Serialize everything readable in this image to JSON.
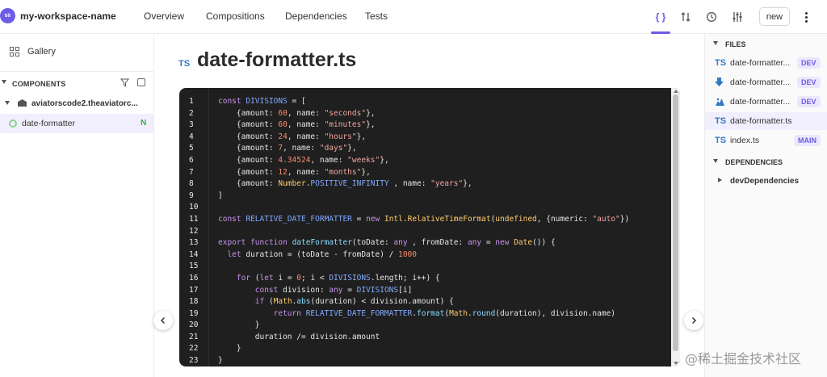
{
  "workspace": {
    "logo_text": "bit",
    "name": "my-workspace-name"
  },
  "nav": {
    "tabs": [
      {
        "label": "Overview"
      },
      {
        "label": "Compositions"
      },
      {
        "label": "Dependencies"
      },
      {
        "label": "Tests"
      }
    ]
  },
  "toolbar": {
    "icons": [
      "code-icon",
      "compare-icon",
      "history-icon",
      "settings-sliders-icon"
    ],
    "code_glyph": "{ }",
    "new_label": "new"
  },
  "sidebar": {
    "gallery_label": "Gallery",
    "components_header": "COMPONENTS",
    "scope_label": "aviatorscode2.theaviatorc...",
    "component": {
      "label": "date-formatter",
      "status": "N"
    }
  },
  "main": {
    "file_type": "TS",
    "title": "date-formatter.ts",
    "code_lines": [
      "const DIVISIONS = [",
      "    {amount: 60, name: \"seconds\"},",
      "    {amount: 60, name: \"minutes\"},",
      "    {amount: 24, name: \"hours\"},",
      "    {amount: 7, name: \"days\"},",
      "    {amount: 4.34524, name: \"weeks\"},",
      "    {amount: 12, name: \"months\"},",
      "    {amount: Number.POSITIVE_INFINITY , name: \"years\"},",
      "]",
      "",
      "const RELATIVE_DATE_FORMATTER = new Intl.RelativeTimeFormat(undefined, {numeric: \"auto\"})",
      "",
      "export function dateFormatter(toDate: any , fromDate: any = new Date()) {",
      "  let duration = (toDate - fromDate) / 1000",
      "",
      "    for (let i = 0; i < DIVISIONS.length; i++) {",
      "        const division: any = DIVISIONS[i]",
      "        if (Math.abs(duration) < division.amount) {",
      "            return RELATIVE_DATE_FORMATTER.format(Math.round(duration), division.name)",
      "        }",
      "        duration /= division.amount",
      "    }",
      "}"
    ]
  },
  "files_panel": {
    "files_header": "FILES",
    "files": [
      {
        "icon": "TS",
        "label": "date-formatter...",
        "tag": "DEV"
      },
      {
        "icon": "download-icon",
        "label": "date-formatter...",
        "tag": "DEV"
      },
      {
        "icon": "composition-icon",
        "label": "date-formatter...",
        "tag": "DEV"
      },
      {
        "icon": "TS",
        "label": "date-formatter.ts",
        "tag": ""
      },
      {
        "icon": "TS",
        "label": "index.ts",
        "tag": "MAIN"
      }
    ],
    "dependencies_header": "DEPENDENCIES",
    "dev_dependencies_label": "devDependencies"
  },
  "watermark": "@稀土掘金技术社区",
  "colors": {
    "accent": "#6c5ce7",
    "ts_blue": "#3178c6",
    "code_bg": "#1f1f1f",
    "new_status": "#37b24d"
  }
}
